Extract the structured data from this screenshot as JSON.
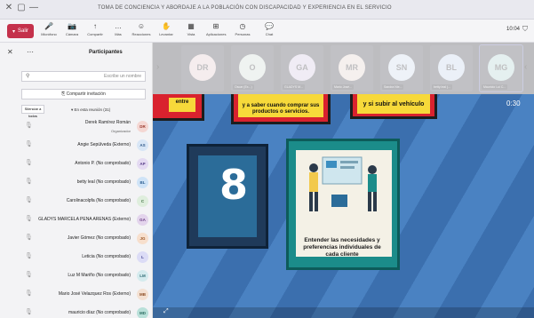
{
  "window": {
    "title": "TOMA DE CONCIENCIA Y ABORDAJE A LA POBLACIÓN CON DISCAPACIDAD Y EXPERIENCIA EN EL SERVICIO"
  },
  "ribbon": {
    "leave_label": "Salir",
    "time": "10:04",
    "tools": [
      {
        "icon": "🎤",
        "label": "Micrófono"
      },
      {
        "icon": "📷",
        "label": "Cámara"
      },
      {
        "icon": "↑",
        "label": "Compartir"
      },
      {
        "icon": "…",
        "label": "Más"
      },
      {
        "icon": "☺",
        "label": "Reacciones"
      },
      {
        "icon": "✋",
        "label": "Levantar"
      },
      {
        "icon": "▦",
        "label": "Vista"
      },
      {
        "icon": "⊞",
        "label": "Aplicaciones"
      },
      {
        "icon": "◷",
        "label": "Personas"
      },
      {
        "icon": "💬",
        "label": "Chat"
      }
    ]
  },
  "strip": {
    "tiles": [
      {
        "initials": "MG",
        "name": "Mauricio Lui C...",
        "bg": "#b9e0d9"
      },
      {
        "initials": "BL",
        "name": "betty leal (...",
        "bg": "#cfe3f7"
      },
      {
        "initials": "SN",
        "name": "Sandra Nie...",
        "bg": "#d9eaf8"
      },
      {
        "initials": "MR",
        "name": "Mario José...",
        "bg": "#f3e0d2"
      },
      {
        "initials": "GA",
        "name": "GLADYS M...",
        "bg": "#e3d4ec"
      },
      {
        "initials": "O",
        "name": "Oscar (Ex...)",
        "bg": "#dfeedd"
      },
      {
        "initials": "DR",
        "name": "",
        "bg": "#f4d7d3"
      }
    ]
  },
  "stage": {
    "clock": "0:30",
    "number": "8",
    "card_text": "Entender las necesidades y preferencias individuales de cada cliente",
    "yellow_1": "y a saber cuando comprar sus productos o servicios.",
    "yellow_2": "y si subir al vehículo",
    "yellow_3": "entre"
  },
  "panel": {
    "title": "Participantes",
    "search_placeholder": "Escribe un nombre",
    "share_label": "Compartir invitación",
    "group_label": "En esta reunión (31)",
    "mute_all": "Silenciar a todos",
    "people": [
      {
        "initials": "DR",
        "name": "Derek Ramírez Román",
        "role": "Organizador",
        "bg": "#f4d7d3",
        "fg": "#9b3a2e"
      },
      {
        "initials": "AS",
        "name": "Angie Sepúlveda (Externo)",
        "role": "",
        "bg": "#d8e6f6",
        "fg": "#345c8c"
      },
      {
        "initials": "AP",
        "name": "Antonio P. (No comprobado)",
        "role": "",
        "bg": "#e4daf2",
        "fg": "#5a3f8a"
      },
      {
        "initials": "BL",
        "name": "betty leal (No comprobado)",
        "role": "",
        "bg": "#cfe3f7",
        "fg": "#2d5f92"
      },
      {
        "initials": "C",
        "name": "Carolinacolpfa (No comprobado)",
        "role": "",
        "bg": "#dfeedd",
        "fg": "#3f7040"
      },
      {
        "initials": "GA",
        "name": "GLADYS MARCELA PEÑA ARENAS (Externo)",
        "role": "",
        "bg": "#e3d4ec",
        "fg": "#6b3d85"
      },
      {
        "initials": "JG",
        "name": "Javier Gómez (No comprobado)",
        "role": "",
        "bg": "#f7dfcd",
        "fg": "#9a5422"
      },
      {
        "initials": "L",
        "name": "Leticia (No comprobado)",
        "role": "",
        "bg": "#dcdcf6",
        "fg": "#3e3f8e"
      },
      {
        "initials": "LM",
        "name": "Luz M Mariño (No comprobado)",
        "role": "",
        "bg": "#d5ebee",
        "fg": "#2f6c75"
      },
      {
        "initials": "MB",
        "name": "Mario José Velazquez Ros (Externo)",
        "role": "",
        "bg": "#f3e0d2",
        "fg": "#8d4f26"
      },
      {
        "initials": "MD",
        "name": "mauricio díaz (No comprobado)",
        "role": "",
        "bg": "#b9e0d9",
        "fg": "#2b6d61"
      }
    ]
  }
}
